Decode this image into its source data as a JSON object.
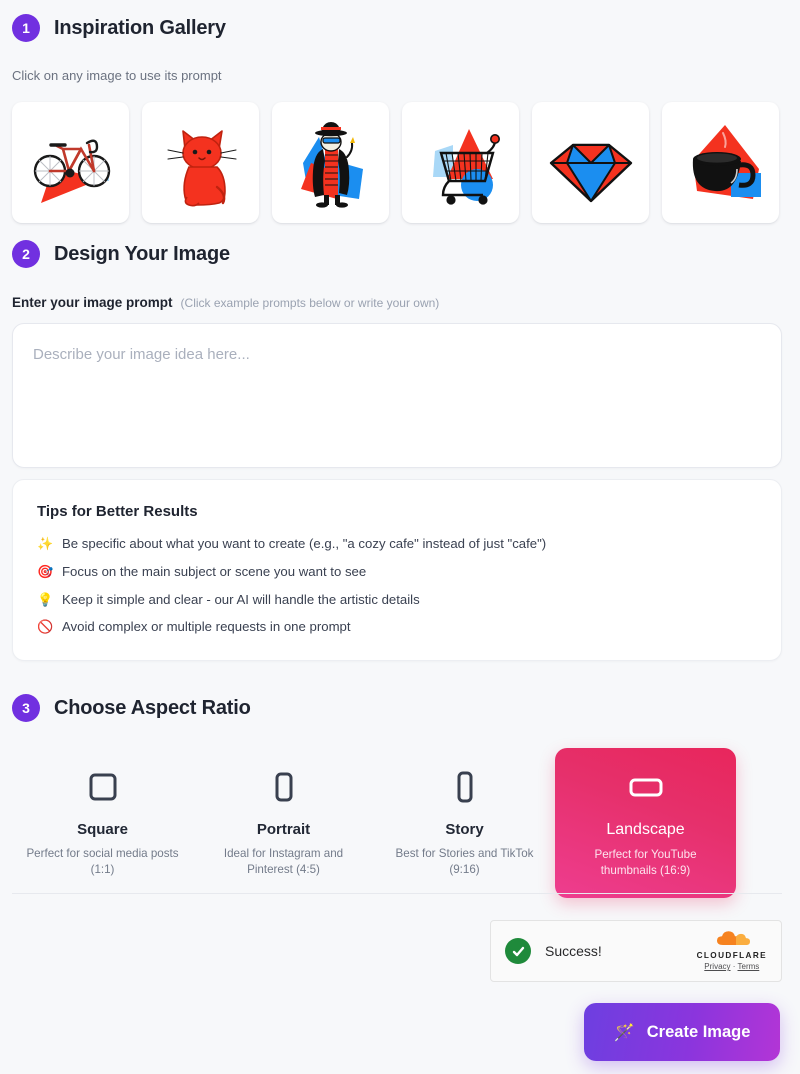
{
  "gallery": {
    "step": "1",
    "title": "Inspiration Gallery",
    "subtitle": "Click on any image to use its prompt",
    "items": [
      {
        "name": "bicycle",
        "icon": "bicycle-illustration"
      },
      {
        "name": "cat",
        "icon": "cat-illustration"
      },
      {
        "name": "detective",
        "icon": "detective-illustration"
      },
      {
        "name": "shopping-cart",
        "icon": "shopping-cart-illustration"
      },
      {
        "name": "diamond",
        "icon": "diamond-illustration"
      },
      {
        "name": "coffee-cup",
        "icon": "coffee-cup-illustration"
      }
    ]
  },
  "design": {
    "step": "2",
    "title": "Design Your Image",
    "prompt_label": "Enter your image prompt",
    "prompt_hint": "(Click example prompts below or write your own)",
    "prompt_value": "",
    "prompt_placeholder": "Describe your image idea here..."
  },
  "tips": {
    "title": "Tips for Better Results",
    "items": [
      {
        "icon": "✨",
        "icon_name": "sparkles-icon",
        "text": "Be specific about what you want to create (e.g., \"a cozy cafe\" instead of just \"cafe\")"
      },
      {
        "icon": "🎯",
        "icon_name": "target-icon",
        "text": "Focus on the main subject or scene you want to see"
      },
      {
        "icon": "💡",
        "icon_name": "lightbulb-icon",
        "text": "Keep it simple and clear - our AI will handle the artistic details"
      },
      {
        "icon": "🚫",
        "icon_name": "prohibited-icon",
        "text": "Avoid complex or multiple requests in one prompt"
      }
    ]
  },
  "aspect_ratio": {
    "step": "3",
    "title": "Choose Aspect Ratio",
    "options": [
      {
        "name": "Square",
        "desc": "Perfect for social media posts (1:1)",
        "ratio": "1:1",
        "selected": false,
        "icon": "square-icon"
      },
      {
        "name": "Portrait",
        "desc": "Ideal for Instagram and Pinterest (4:5)",
        "ratio": "4:5",
        "selected": false,
        "icon": "portrait-icon"
      },
      {
        "name": "Story",
        "desc": "Best for Stories and TikTok (9:16)",
        "ratio": "9:16",
        "selected": false,
        "icon": "story-icon"
      },
      {
        "name": "Landscape",
        "desc": "Perfect for YouTube thumbnails (16:9)",
        "ratio": "16:9",
        "selected": true,
        "icon": "landscape-icon"
      }
    ],
    "selected": "Landscape"
  },
  "turnstile": {
    "status": "Success!",
    "brand": "CLOUDFLARE",
    "privacy_link": "Privacy",
    "separator": "·",
    "terms_link": "Terms"
  },
  "actions": {
    "create_label": "Create Image",
    "create_icon": "🪄"
  },
  "colors": {
    "background": "#f7f8fa",
    "step_badge": "#7130e0",
    "selected_card_start": "#e8265c",
    "selected_card_end": "#ee3d8f",
    "create_button_start": "#6d3fe0",
    "create_button_end": "#b335d6",
    "success_green": "#1f8a3b",
    "illustration_red": "#f4321f",
    "illustration_blue": "#1b8ef0"
  }
}
